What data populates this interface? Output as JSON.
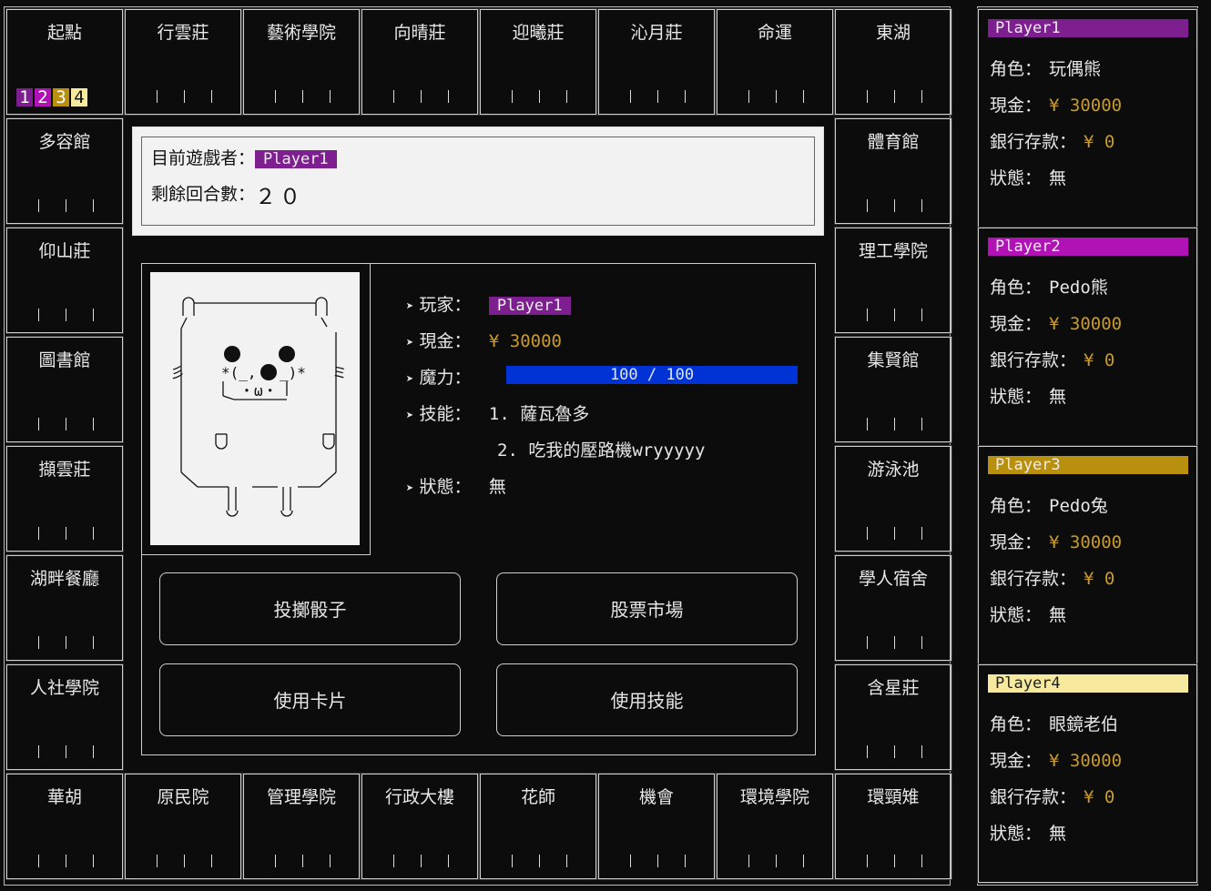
{
  "colors": {
    "background": "#0c0c0c",
    "player1": "#7d1f8f",
    "player2": "#b012b5",
    "player3": "#b8900e",
    "player4": "#f7ea9e",
    "money": "#c89b2a",
    "mana_bar": "#0033d6"
  },
  "board": {
    "top": [
      "起點",
      "行雲莊",
      "藝術學院",
      "向晴莊",
      "迎曦莊",
      "沁月莊",
      "命運",
      "東湖"
    ],
    "left": [
      "多容館",
      "仰山莊",
      "圖書館",
      "擷雲莊",
      "湖畔餐廳",
      "人社學院"
    ],
    "right": [
      "體育館",
      "理工學院",
      "集賢館",
      "游泳池",
      "學人宿舍",
      "含星莊"
    ],
    "bottom": [
      "華胡",
      "原民院",
      "管理學院",
      "行政大樓",
      "花師",
      "機會",
      "環境學院",
      "環頸雉"
    ],
    "start_pieces": [
      "1",
      "2",
      "3",
      "4"
    ]
  },
  "status_box": {
    "current_player_label": "目前遊戲者：",
    "current_player": "Player1",
    "turns_label": "剩餘回合數：",
    "turns_value": "２０"
  },
  "detail": {
    "portrait_ascii": "  ∩___________∩\n  |ノ          ヽ\n  |            |\n  |   ●    ●   |\n 彡  *(_,●_)*   ミ\n  |   |・ω・|    |\n  |            |\n  |            |\n  | ∪        ∪ |\n  |            |\n  ＼___|___|___/\n      ||   ||\n      ∪    ∪",
    "player_label": "玩家：",
    "player_value": "Player1",
    "cash_label": "現金：",
    "cash_value": "¥ 30000",
    "mana_label": "魔力：",
    "mana_text": "100  /  100",
    "mana_current": 100,
    "mana_max": 100,
    "skill_label": "技能：",
    "skill_1": "1. 薩瓦魯多",
    "skill_2": "2. 吃我的壓路機wryyyyy",
    "state_label": "狀態：",
    "state_value": "無"
  },
  "buttons": {
    "roll": "投擲骰子",
    "stock": "股票市場",
    "card": "使用卡片",
    "skill": "使用技能"
  },
  "labels": {
    "role": "角色：",
    "cash": "現金：",
    "bank": "銀行存款：",
    "state": "狀態："
  },
  "players": [
    {
      "name": "Player1",
      "role": "玩偶熊",
      "cash": "¥ 30000",
      "bank": "¥ 0",
      "state": "無"
    },
    {
      "name": "Player2",
      "role": "Pedo熊",
      "cash": "¥ 30000",
      "bank": "¥ 0",
      "state": "無"
    },
    {
      "name": "Player3",
      "role": "Pedo兔",
      "cash": "¥ 30000",
      "bank": "¥ 0",
      "state": "無"
    },
    {
      "name": "Player4",
      "role": "眼鏡老伯",
      "cash": "¥ 30000",
      "bank": "¥ 0",
      "state": "無"
    }
  ]
}
